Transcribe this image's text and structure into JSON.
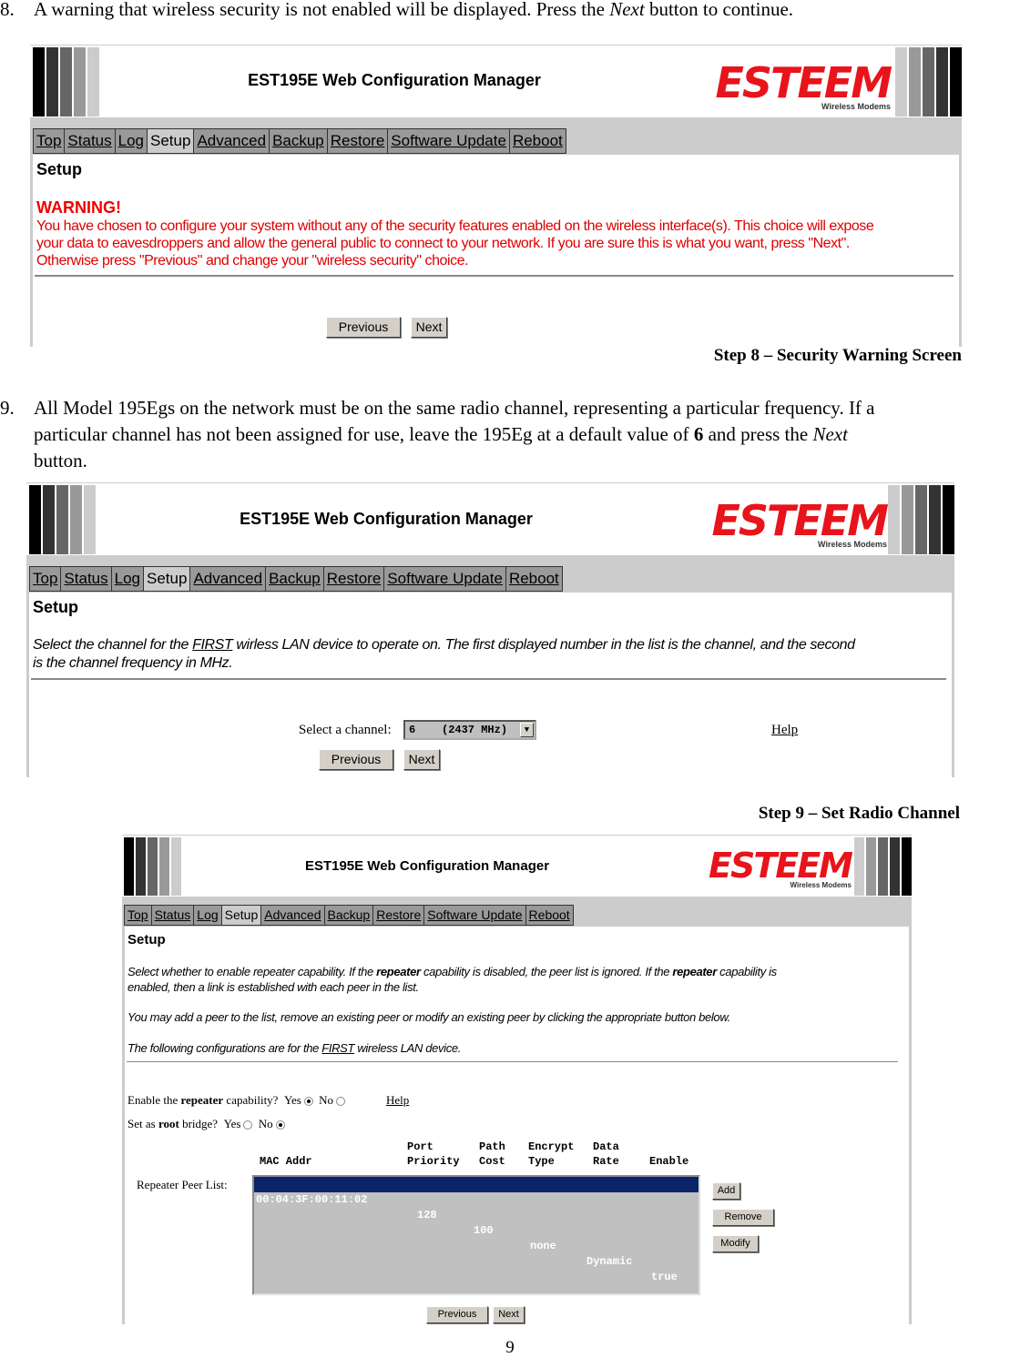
{
  "step8": {
    "number": "8.",
    "text_before": "A warning that wireless security is not enabled will be displayed. Press the ",
    "text_italic": "Next",
    "text_after": " button to continue.",
    "caption": "Step 8 – Security Warning Screen"
  },
  "step9": {
    "number": "9.",
    "line1": "All Model 195Egs on the network must be on the same radio channel, representing a particular frequency.  If a",
    "line2_before": "particular channel has not been assigned for use, leave the 195Eg at a default value of ",
    "line2_bold": "6",
    "line2_mid": " and press the ",
    "line2_italic": "Next",
    "line3": "button.",
    "caption": "Step 9 – Set Radio Channel"
  },
  "app": {
    "title": "EST195E Web Configuration Manager",
    "logo_brand": "ESTEEM",
    "logo_sub": "Wireless Modems",
    "nav": [
      "Top",
      "Status",
      "Log",
      "Setup",
      "Advanced",
      "Backup",
      "Restore",
      "Software Update",
      "Reboot"
    ],
    "active_nav": "Setup",
    "bar_colors": [
      "#000000",
      "#333333",
      "#666666",
      "#999999",
      "#cccccc"
    ],
    "brand_color": "#e8131b"
  },
  "screen1": {
    "heading": "Setup",
    "warning_title": "WARNING!",
    "warning_line1": "You have chosen to configure your system without any of the security features enabled on the wireless interface(s). This choice will expose",
    "warning_line2": "your data to eavesdroppers and allow the general public to connect to your network. If you are sure this is what you want, press \"Next\".",
    "warning_line3": "Otherwise press \"Previous\" and change your \"wireless security\" choice.",
    "previous": "Previous",
    "next": "Next"
  },
  "screen2": {
    "heading": "Setup",
    "desc_a": "Select the channel for the ",
    "desc_u": "FIRST",
    "desc_b": " wirless LAN device to operate on. The first displayed number in the list is the channel, and the second",
    "desc_c": "is the channel frequency in MHz.",
    "select_label": "Select a channel:",
    "select_value": "6    (2437 MHz)",
    "help": "Help",
    "previous": "Previous",
    "next": "Next"
  },
  "screen3": {
    "heading": "Setup",
    "p1_a": "Select whether to enable repeater capability. If the ",
    "p1_b": "repeater",
    "p1_c": " capability is disabled, the peer list is ignored. If the ",
    "p1_d": "repeater",
    "p1_e": " capability is",
    "p1_line2": "enabled, then a link is established with each peer in the list.",
    "p2": "You may add a peer to the list, remove an existing peer or modify an existing peer by clicking the appropriate button below.",
    "p3_a": "The following configurations are for the ",
    "p3_u": "FIRST",
    "p3_b": " wireless LAN device.",
    "repeater_q_a": "Enable the ",
    "repeater_q_b": "repeater",
    "repeater_q_c": " capability?",
    "yes": "Yes",
    "no": "No",
    "repeater_value": "Yes",
    "help": "Help",
    "root_q_a": "Set as ",
    "root_q_b": "root",
    "root_q_c": " bridge?",
    "root_value": "No",
    "columns_line1": "                   Port      Path   Encrypt  Data",
    "columns_line2": "      MAC Addr          Priority  Cost   Type     Rate    Enable",
    "columns": [
      "MAC Addr",
      "Port Priority",
      "Path Cost",
      "Encrypt Type",
      "Data Rate",
      "Enable"
    ],
    "peer_list_label": "Repeater Peer List:",
    "peers": [
      {
        "mac": "00:04:3F:00:11:02",
        "port_priority": "128",
        "path_cost": "100",
        "encrypt_type": "none",
        "data_rate": "Dynamic",
        "enable": "true",
        "selected": true
      }
    ],
    "add": "Add",
    "remove": "Remove",
    "modify": "Modify",
    "previous": "Previous",
    "next": "Next"
  },
  "page_number": "9"
}
